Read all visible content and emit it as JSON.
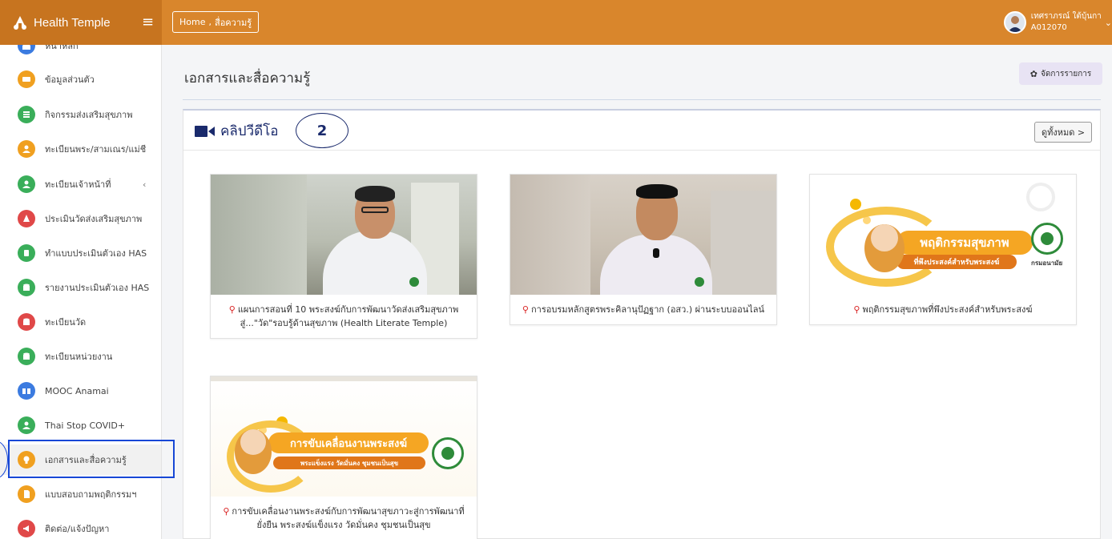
{
  "app": {
    "brand": "Health Temple",
    "breadcrumb": [
      "Home",
      "สื่อความรู้"
    ],
    "user_name": "เทศราภรณ์ ใต้บุ้นกา",
    "user_id": "A012070"
  },
  "sidebar": {
    "items": [
      {
        "label": "หน้าหลัก",
        "color": "#3b7be0"
      },
      {
        "label": "ข้อมูลส่วนตัว",
        "color": "#f0a020"
      },
      {
        "label": "กิจกรรมส่งเสริมสุขภาพ",
        "color": "#3aae5a"
      },
      {
        "label": "ทะเบียนพระ/สามเณร/แม่ชี",
        "color": "#f0a020"
      },
      {
        "label": "ทะเบียนเจ้าหน้าที่",
        "color": "#3aae5a"
      },
      {
        "label": "ประเมินวัดส่งเสริมสุขภาพ",
        "color": "#e04848"
      },
      {
        "label": "ทำแบบประเมินตัวเอง HAS",
        "color": "#3aae5a"
      },
      {
        "label": "รายงานประเมินตัวเอง HAS",
        "color": "#3aae5a"
      },
      {
        "label": "ทะเบียนวัด",
        "color": "#e04848"
      },
      {
        "label": "ทะเบียนหน่วยงาน",
        "color": "#3aae5a"
      },
      {
        "label": "MOOC Anamai",
        "color": "#3b7be0"
      },
      {
        "label": "Thai Stop COVID+",
        "color": "#3aae5a"
      },
      {
        "label": "เอกสารและสื่อความรู้",
        "color": "#f0a020"
      },
      {
        "label": "แบบสอบถามพฤติกรรมฯ",
        "color": "#f0a020"
      },
      {
        "label": "ติดต่อ/แจ้งปัญหา",
        "color": "#e04848"
      }
    ]
  },
  "main": {
    "page_title": "เอกสารและสื่อความรู้",
    "manage_label": "จัดการรายการ",
    "panel_title": "คลิปวีดีโอ",
    "step_number": "2",
    "view_all_label": "ดูทั้งหมด >"
  },
  "videos": [
    {
      "caption": "แผนการสอนที่ 10 พระสงฆ์กับการพัฒนาวัดส่งเสริมสุขภาพ สู่...\"วัด\"รอบรู้ด้านสุขภาพ (Health Literate Temple)"
    },
    {
      "caption": "การอบรมหลักสูตรพระคิลานุปัฏฐาก (อสว.) ผ่านระบบออนไลน์"
    },
    {
      "caption": "พฤติกรรมสุขภาพที่พึงประสงค์สำหรับพระสงฆ์"
    },
    {
      "caption": "การขับเคลื่อนงานพระสงฆ์กับการพัฒนาสุขภาวะสู่การพัฒนาที่ยั่งยืน พระสงฆ์แข็งแรง วัดมั่นคง ชุมชนเป็นสุข"
    }
  ],
  "thumbnails": {
    "poster1_title": "พฤติกรรมสุขภาพ",
    "poster1_subtitle": "ที่พึงประสงค์สำหรับพระสงฆ์",
    "poster1_org": "กรมอนามัย",
    "poster2_title": "การขับเคลื่อนงานพระสงฆ์",
    "poster2_subtitle": "พระแข็งแรง วัดมั่นคง ชุมชนเป็นสุข"
  },
  "colors": {
    "topbar": "#d9862c",
    "brand_bg": "#c7741f",
    "accent_blue": "#1a2a6c",
    "highlight": "#1747d6",
    "pin": "#d82020"
  }
}
